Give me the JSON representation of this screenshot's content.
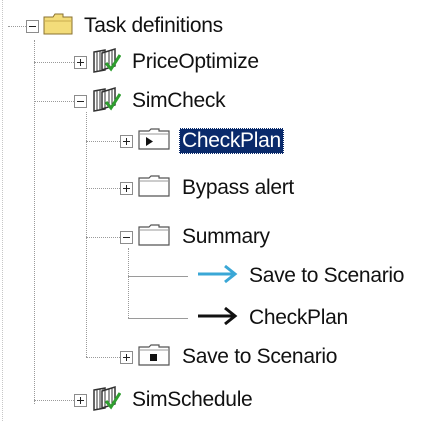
{
  "tree": {
    "root": {
      "label": "Task definitions",
      "icon": "folder-open-icon"
    },
    "items": [
      {
        "label": "PriceOptimize",
        "icon": "task-definition-icon"
      },
      {
        "label": "SimCheck",
        "icon": "task-definition-icon"
      },
      {
        "label": "CheckPlan",
        "icon": "play-folder-icon",
        "selected": true
      },
      {
        "label": "Bypass alert",
        "icon": "folder-icon"
      },
      {
        "label": "Summary",
        "icon": "folder-icon"
      },
      {
        "label": "Save to Scenario",
        "icon": "blue-arrow-icon",
        "arrow_color": "#3aa7d6"
      },
      {
        "label": "CheckPlan",
        "icon": "black-arrow-icon",
        "arrow_color": "#111111"
      },
      {
        "label": "Save to Scenario",
        "icon": "stop-folder-icon"
      },
      {
        "label": "SimSchedule",
        "icon": "task-definition-icon"
      }
    ]
  },
  "colors": {
    "selection": "#0a2a6b",
    "tree_line": "#9a9a9a",
    "folder_yellow": "#f3dc7a"
  }
}
